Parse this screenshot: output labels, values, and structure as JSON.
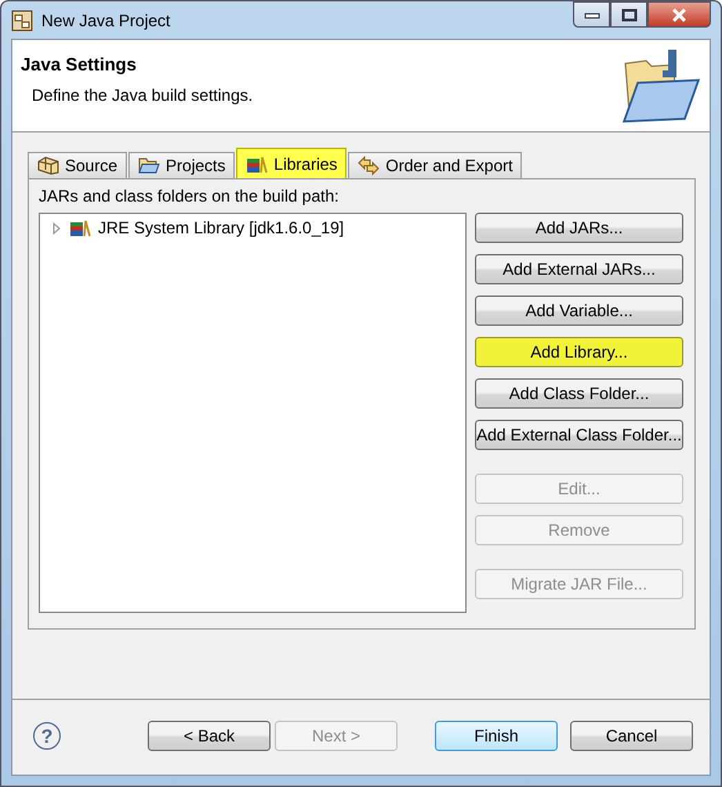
{
  "window": {
    "title": "New Java Project"
  },
  "header": {
    "title": "Java Settings",
    "description": "Define the Java build settings."
  },
  "tabs": [
    {
      "label": "Source",
      "kind": "source",
      "selected": false
    },
    {
      "label": "Projects",
      "kind": "projects",
      "selected": false
    },
    {
      "label": "Libraries",
      "kind": "libraries",
      "selected": true
    },
    {
      "label": "Order and Export",
      "kind": "order",
      "selected": false
    }
  ],
  "libraries": {
    "caption": "JARs and class folders on the build path:",
    "tree": [
      {
        "label": "JRE System Library [jdk1.6.0_19]",
        "expanded": false
      }
    ],
    "button_groups": [
      [
        {
          "label": "Add JARs...",
          "highlighted": false,
          "disabled": false
        },
        {
          "label": "Add External JARs...",
          "highlighted": false,
          "disabled": false
        },
        {
          "label": "Add Variable...",
          "highlighted": false,
          "disabled": false
        },
        {
          "label": "Add Library...",
          "highlighted": true,
          "disabled": false
        },
        {
          "label": "Add Class Folder...",
          "highlighted": false,
          "disabled": false
        },
        {
          "label": "Add External Class Folder...",
          "highlighted": false,
          "disabled": false
        }
      ],
      [
        {
          "label": "Edit...",
          "highlighted": false,
          "disabled": true
        },
        {
          "label": "Remove",
          "highlighted": false,
          "disabled": true
        }
      ],
      [
        {
          "label": "Migrate JAR File...",
          "highlighted": false,
          "disabled": true
        }
      ]
    ]
  },
  "footer": {
    "help": "?",
    "buttons": [
      {
        "label": "< Back",
        "default": false,
        "disabled": false
      },
      {
        "label": "Next >",
        "default": false,
        "disabled": true
      },
      {
        "label": "Finish",
        "default": true,
        "disabled": false
      },
      {
        "label": "Cancel",
        "default": false,
        "disabled": false
      }
    ]
  }
}
